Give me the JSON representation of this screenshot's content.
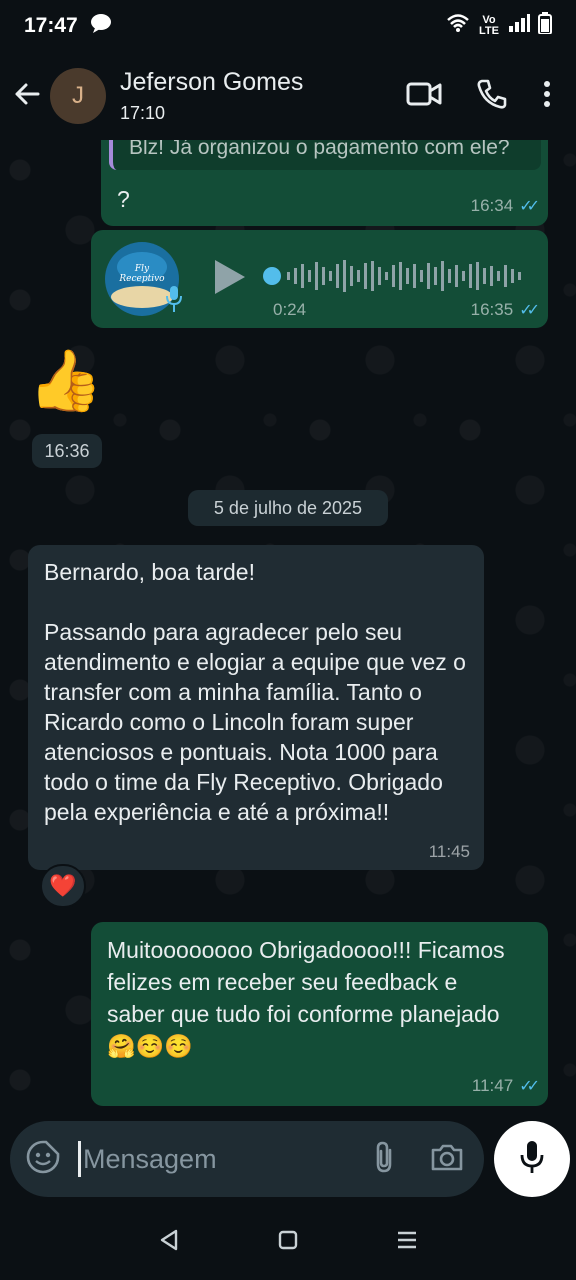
{
  "status": {
    "time": "17:47",
    "network": "Vo LTE"
  },
  "header": {
    "avatar_letter": "J",
    "name": "Jeferson Gomes",
    "subtitle": "17:10"
  },
  "messages": {
    "m1": {
      "quote": "Blz! Já organizou o pagamento com ele?",
      "text": "?",
      "time": "16:34"
    },
    "m2": {
      "duration": "0:24",
      "time": "16:35",
      "avatar_text": "Fly Receptivo"
    },
    "m3": {
      "emoji": "👍",
      "time": "16:36"
    },
    "date": "5 de julho de 2025",
    "m4": {
      "text": "Bernardo, boa tarde!\n\nPassando para agradecer pelo seu atendimento e elogiar a equipe que vez o transfer com a minha família. Tanto o Ricardo como o Lincoln foram super atenciosos e pontuais. Nota 1000 para todo o time da Fly Receptivo. Obrigado pela experiência e até a próxima!!",
      "time": "11:45",
      "reaction": "❤️"
    },
    "m5": {
      "text": "Muitoooooooo Obrigadoooo!!! Ficamos felizes em receber seu feedback e saber que tudo foi conforme planejado 🤗☺️☺️",
      "time": "11:47"
    }
  },
  "composer": {
    "placeholder": "Mensagem"
  },
  "colors": {
    "outgoing": "#134d37",
    "incoming": "#202c33",
    "tick": "#53bdeb",
    "background": "#0b1014"
  }
}
